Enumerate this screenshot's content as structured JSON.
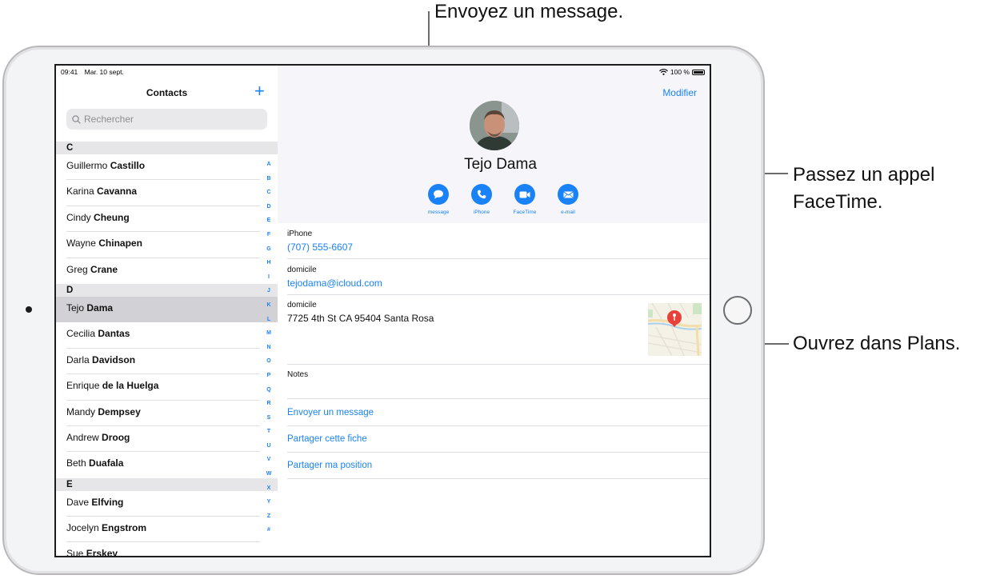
{
  "callouts": {
    "message": "Envoyez un message.",
    "facetime_line1": "Passez un appel",
    "facetime_line2": "FaceTime.",
    "maps": "Ouvrez dans Plans."
  },
  "status": {
    "time": "09:41",
    "date": "Mar. 10 sept.",
    "battery": "100 %",
    "wifi_icon": "wifi-icon",
    "battery_icon": "battery-icon"
  },
  "sidebar": {
    "title": "Contacts",
    "add_icon": "plus-icon",
    "search_placeholder": "Rechercher",
    "sections": [
      {
        "letter": "C",
        "contacts": [
          {
            "first": "Guillermo",
            "last": "Castillo"
          },
          {
            "first": "Karina",
            "last": "Cavanna"
          },
          {
            "first": "Cindy",
            "last": "Cheung"
          },
          {
            "first": "Wayne",
            "last": "Chinapen"
          },
          {
            "first": "Greg",
            "last": "Crane"
          }
        ]
      },
      {
        "letter": "D",
        "contacts": [
          {
            "first": "Tejo",
            "last": "Dama",
            "selected": true
          },
          {
            "first": "Cecilia",
            "last": "Dantas"
          },
          {
            "first": "Darla",
            "last": "Davidson"
          },
          {
            "first": "Enrique",
            "last": "de la Huelga"
          },
          {
            "first": "Mandy",
            "last": "Dempsey"
          },
          {
            "first": "Andrew",
            "last": "Droog"
          },
          {
            "first": "Beth",
            "last": "Duafala"
          }
        ]
      },
      {
        "letter": "E",
        "contacts": [
          {
            "first": "Dave",
            "last": "Elfving"
          },
          {
            "first": "Jocelyn",
            "last": "Engstrom"
          },
          {
            "first": "Sue",
            "last": "Erskey"
          }
        ]
      }
    ],
    "index": [
      "A",
      "B",
      "C",
      "D",
      "E",
      "F",
      "G",
      "H",
      "I",
      "J",
      "K",
      "L",
      "M",
      "N",
      "O",
      "P",
      "Q",
      "R",
      "S",
      "T",
      "U",
      "V",
      "W",
      "X",
      "Y",
      "Z",
      "#"
    ]
  },
  "detail": {
    "edit_label": "Modifier",
    "name": "Tejo Dama",
    "actions": [
      {
        "label": "message",
        "icon": "message-bubble-icon"
      },
      {
        "label": "iPhone",
        "icon": "phone-icon"
      },
      {
        "label": "FaceTime",
        "icon": "video-camera-icon"
      },
      {
        "label": "e-mail",
        "icon": "envelope-icon"
      }
    ],
    "phone": {
      "label": "iPhone",
      "value": "(707) 555-6607"
    },
    "email": {
      "label": "domicile",
      "value": "tejodama@icloud.com"
    },
    "address": {
      "label": "domicile",
      "value": "7725 4th St CA 95404 Santa Rosa"
    },
    "notes_label": "Notes",
    "links": [
      "Envoyer un message",
      "Partager cette fiche",
      "Partager ma position"
    ]
  },
  "colors": {
    "accent": "#1a82f7",
    "pin": "#e8413b"
  }
}
